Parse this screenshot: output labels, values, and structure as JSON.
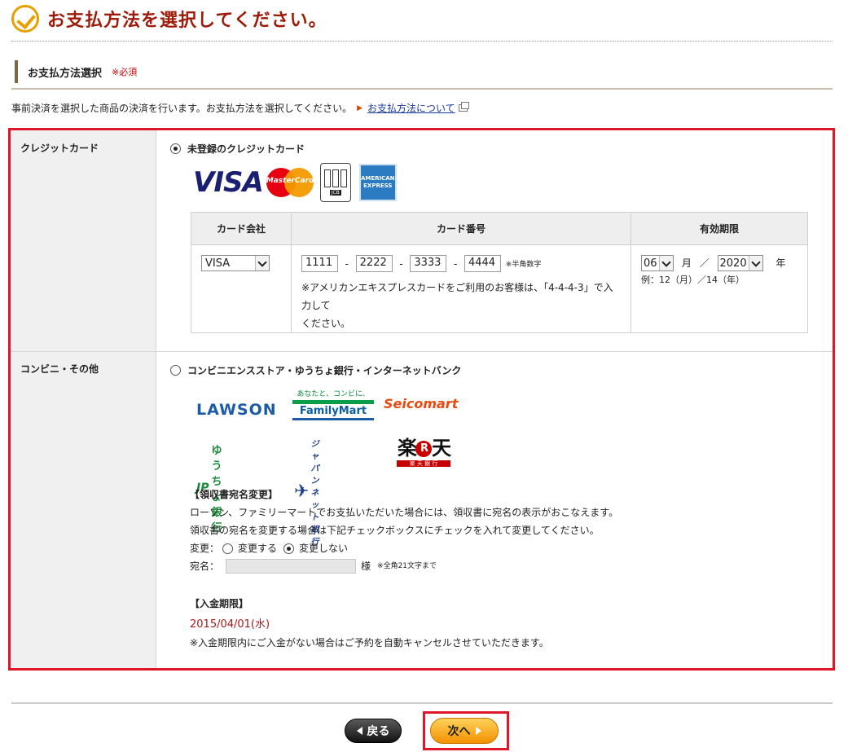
{
  "page": {
    "title": "お支払方法を選択してください。"
  },
  "section": {
    "heading": "お支払方法選択",
    "required": "※必須"
  },
  "intro": {
    "text": "事前決済を選択した商品の決済を行います。お支払方法を選択してください。",
    "link": "お支払方法について"
  },
  "credit": {
    "row_label": "クレジットカード",
    "option_label": "未登録のクレジットカード",
    "selected": true,
    "logos": {
      "visa": "VISA",
      "mastercard": "MasterCard",
      "jcb": "JCB",
      "amex": "AMERICAN EXPRESS"
    },
    "headers": [
      "カード会社",
      "カード番号",
      "有効期限"
    ],
    "company": "VISA",
    "numbers": [
      "1111",
      "2222",
      "3333",
      "4444"
    ],
    "number_sep": "-",
    "number_note": "※半角数字",
    "amex_note_1": "※アメリカンエキスプレスカードをご利用のお客様は、「4-4-4-3」で入力して",
    "amex_note_2": "ください。",
    "exp_month": "06",
    "month_unit": "月",
    "slash": "／",
    "exp_year": "2020",
    "year_unit": "年",
    "exp_example": "例：12（月）／14（年）"
  },
  "conv": {
    "row_label": "コンビニ・その他",
    "option_label": "コンビニエンスストア・ゆうちょ銀行・インターネットバンク",
    "selected": false,
    "logos": {
      "lawson": "LAWSON",
      "fm_tag": "あなたと、コンビに、",
      "fm": "FamilyMart",
      "seico": "Seicomart",
      "yucho_jp": "JP",
      "yucho": "ゆうちょ銀行",
      "japannet": "ジャパンネット銀行",
      "rakuten_1": "楽",
      "rakuten_r": "R",
      "rakuten_2": "天",
      "rakuten_sub": "楽 天 銀 行"
    },
    "receipt_title": "【領収書宛名変更】",
    "receipt_line1": "ローソン、ファミリーマートでお支払いただいた場合には、領収書に宛名の表示がおこなえます。",
    "receipt_line2": "領収書の宛名を変更する場合は下記チェックボックスにチェックを入れて変更してください。",
    "change_label": "変更：",
    "change_yes": "変更する",
    "change_no": "変更しない",
    "name_label": "宛名：",
    "name_value": "",
    "name_suffix": "様",
    "name_note": "※全角21文字まで",
    "deadline_title": "【入金期限】",
    "deadline_date": "2015/04/01(水)",
    "deadline_note": "※入金期限内にご入金がない場合はご予約を自動キャンセルさせていただきます。"
  },
  "buttons": {
    "back": "戻る",
    "next": "次へ"
  },
  "colors": {
    "accent": "#9e1b0a",
    "highlight": "#e0172b",
    "next_orange": "#f29100"
  }
}
